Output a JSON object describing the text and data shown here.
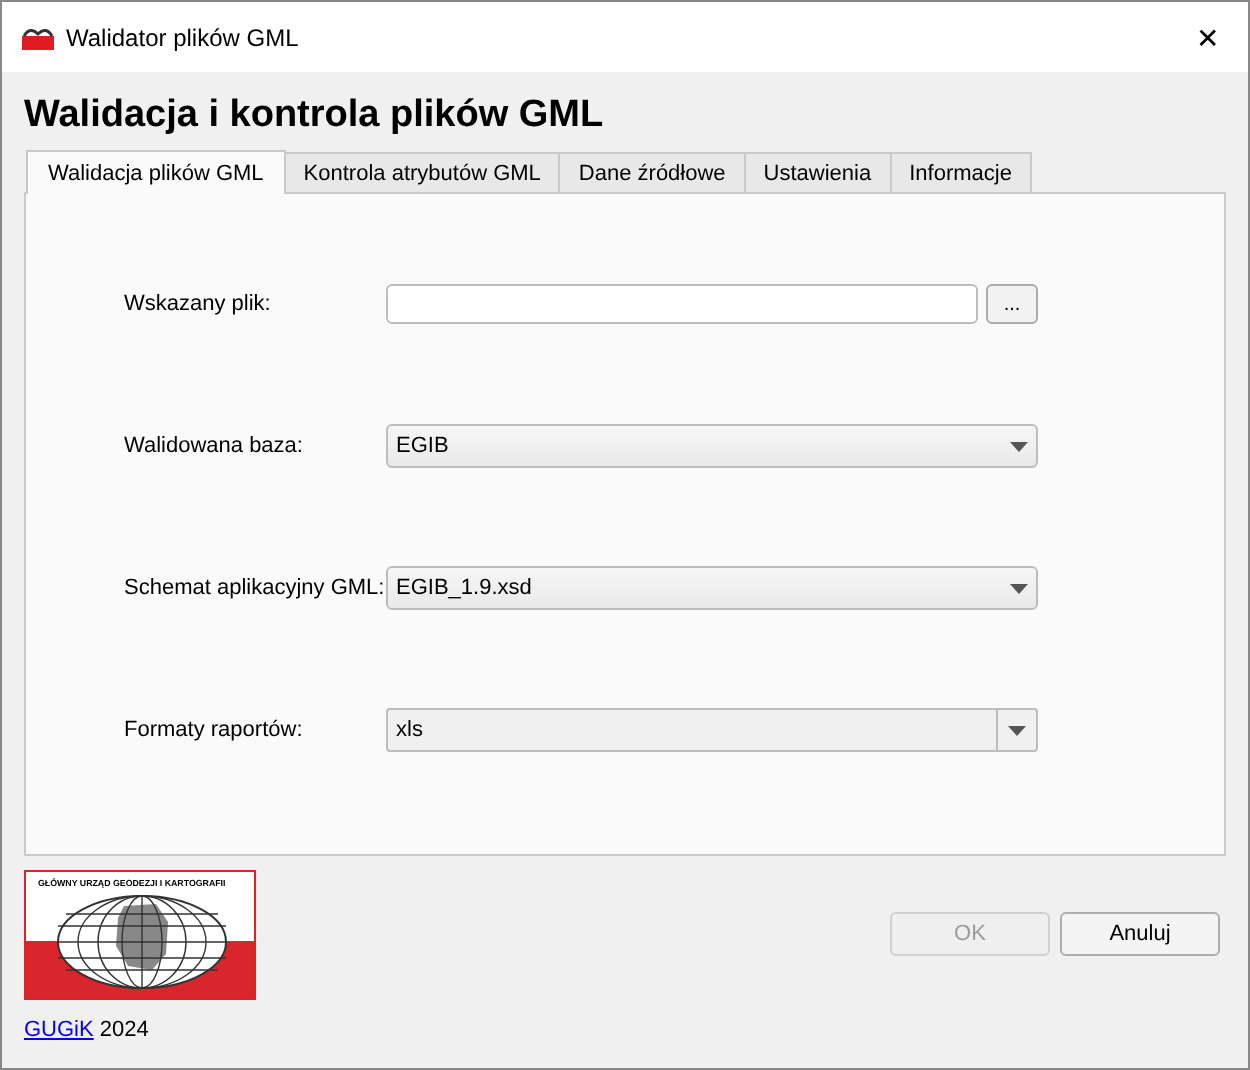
{
  "window": {
    "title": "Walidator plików GML",
    "close": "✕"
  },
  "heading": "Walidacja i kontrola plików GML",
  "tabs": [
    {
      "label": "Walidacja plików GML",
      "selected": true
    },
    {
      "label": "Kontrola atrybutów GML",
      "selected": false
    },
    {
      "label": "Dane źródłowe",
      "selected": false
    },
    {
      "label": "Ustawienia",
      "selected": false
    },
    {
      "label": "Informacje",
      "selected": false
    }
  ],
  "fields": [
    {
      "kind": "file",
      "label": "Wskazany plik:",
      "button": "..."
    },
    {
      "kind": "combo",
      "label": "Walidowana baza:",
      "value": "EGIB"
    },
    {
      "kind": "combo",
      "label": "Schemat aplikacyjny GML:",
      "value": "EGIB_1.9.xsd"
    },
    {
      "kind": "editable",
      "label": "Formaty raportów:",
      "value": "xls"
    }
  ],
  "logo": {
    "caption": "GŁÓWNY URZĄD GEODEZJI I KARTOGRAFII"
  },
  "footer": {
    "link": "GUGiK",
    "year": "2024"
  },
  "buttons": [
    {
      "label": "OK",
      "disabled": true
    },
    {
      "label": "Anuluj",
      "disabled": false
    }
  ]
}
